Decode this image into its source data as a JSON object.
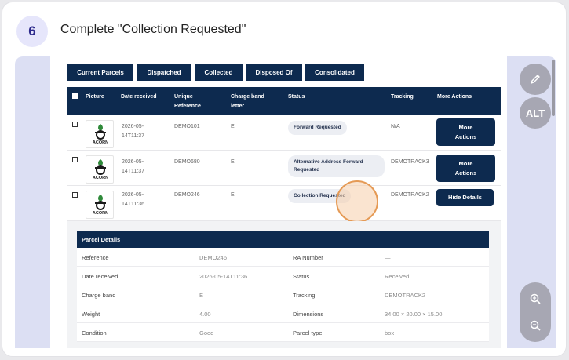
{
  "step": {
    "number": "6",
    "title": "Complete \"Collection Requested\""
  },
  "tabs": [
    "Current Parcels",
    "Dispatched",
    "Collected",
    "Disposed Of",
    "Consolidated"
  ],
  "table": {
    "headers": {
      "picture": "Picture",
      "date_received": "Date received",
      "unique_ref": "Unique Reference",
      "charge_band": "Charge band letter",
      "status": "Status",
      "tracking": "Tracking",
      "more_actions": "More Actions"
    },
    "rows": [
      {
        "date": "2026-05-14T11:37",
        "reference": "DEMO101",
        "charge": "E",
        "status": "Forward Requested",
        "tracking": "N/A",
        "action": "More Actions"
      },
      {
        "date": "2026-05-14T11:37",
        "reference": "DEMO680",
        "charge": "E",
        "status": "Alternative Address Forward Requested",
        "tracking": "DEMOTRACK3",
        "action": "More Actions"
      },
      {
        "date": "2026-05-14T11:36",
        "reference": "DEMO246",
        "charge": "E",
        "status": "Collection Requested",
        "tracking": "DEMOTRACK2",
        "action": "Hide Details"
      }
    ],
    "logo_text": "ACORN"
  },
  "parcel_details": {
    "title": "Parcel Details",
    "rows": [
      {
        "l1": "Reference",
        "v1": "DEMO246",
        "l2": "RA Number",
        "v2": "—"
      },
      {
        "l1": "Date received",
        "v1": "2026-05-14T11:36",
        "l2": "Status",
        "v2": "Received"
      },
      {
        "l1": "Charge band",
        "v1": "E",
        "l2": "Tracking",
        "v2": "DEMOTRACK2"
      },
      {
        "l1": "Weight",
        "v1": "4.00",
        "l2": "Dimensions",
        "v2": "34.00 × 20.00 × 15.00"
      },
      {
        "l1": "Condition",
        "v1": "Good",
        "l2": "Parcel type",
        "v2": "box"
      }
    ]
  },
  "side": {
    "alt_label": "ALT"
  },
  "colors": {
    "navy": "#0d2a4f",
    "accent_ring": "#e59a55",
    "logo_green": "#2f8a3a"
  }
}
